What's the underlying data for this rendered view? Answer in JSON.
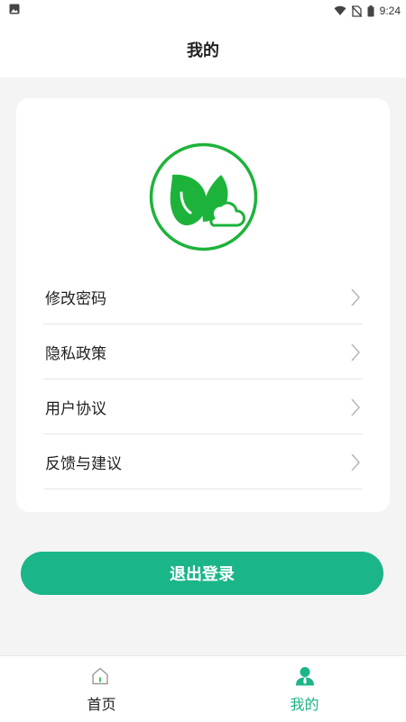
{
  "status_bar": {
    "time": "9:24",
    "icons": [
      "gallery-icon",
      "wifi-icon",
      "no-sim-icon",
      "battery-icon"
    ]
  },
  "header": {
    "title": "我的"
  },
  "profile": {
    "logo_icon": "leaf-cloud-logo",
    "accent_color": "#1db33a"
  },
  "menu": {
    "items": [
      {
        "label": "修改密码",
        "icon": "chevron-right-icon"
      },
      {
        "label": "隐私政策",
        "icon": "chevron-right-icon"
      },
      {
        "label": "用户协议",
        "icon": "chevron-right-icon"
      },
      {
        "label": "反馈与建议",
        "icon": "chevron-right-icon"
      }
    ]
  },
  "logout": {
    "label": "退出登录",
    "color": "#1ab588"
  },
  "bottom_nav": {
    "tabs": [
      {
        "label": "首页",
        "icon": "home-icon",
        "active": false
      },
      {
        "label": "我的",
        "icon": "person-icon",
        "active": true
      }
    ],
    "active_color": "#1ab588"
  }
}
